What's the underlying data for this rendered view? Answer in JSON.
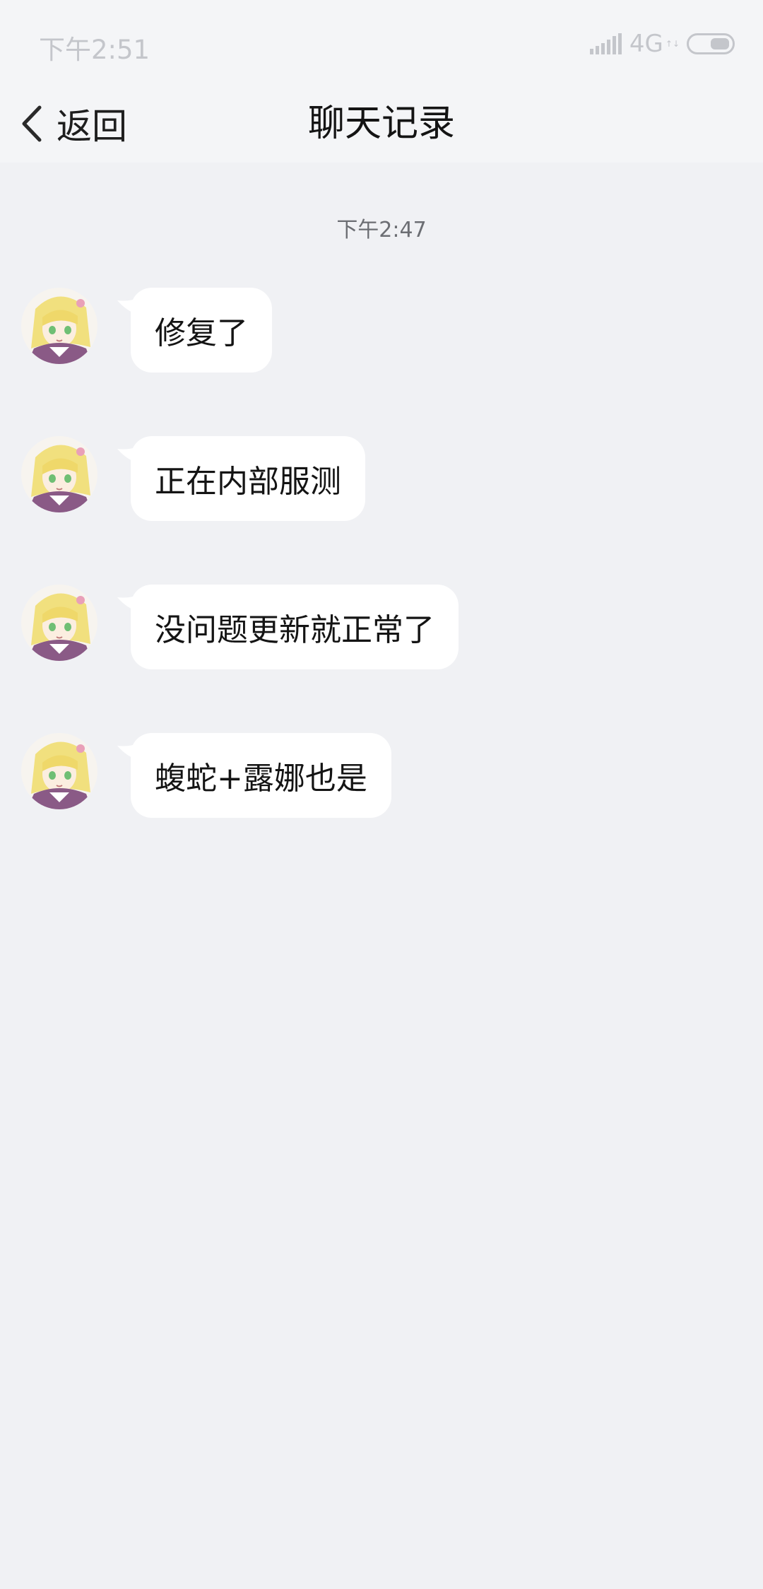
{
  "status_bar": {
    "time": "下午2:51",
    "network": "4G",
    "network_arrows": "↑↓"
  },
  "nav": {
    "back_label": "返回",
    "title": "聊天记录"
  },
  "chat": {
    "timestamp": "下午2:47",
    "messages": [
      {
        "text": "修复了"
      },
      {
        "text": "正在内部服测"
      },
      {
        "text": "没问题更新就正常了"
      },
      {
        "text": "蝮蛇+露娜也是"
      }
    ]
  },
  "colors": {
    "background": "#f0f1f4",
    "bar_background": "#f4f5f7",
    "bubble": "#ffffff",
    "text_primary": "#141414",
    "status_text": "#c4c6cb",
    "timestamp_text": "#6c6e73"
  },
  "icons": {
    "signal": "signal-bars-icon",
    "battery": "battery-icon",
    "back": "chevron-left-icon",
    "avatar": "anime-avatar"
  }
}
